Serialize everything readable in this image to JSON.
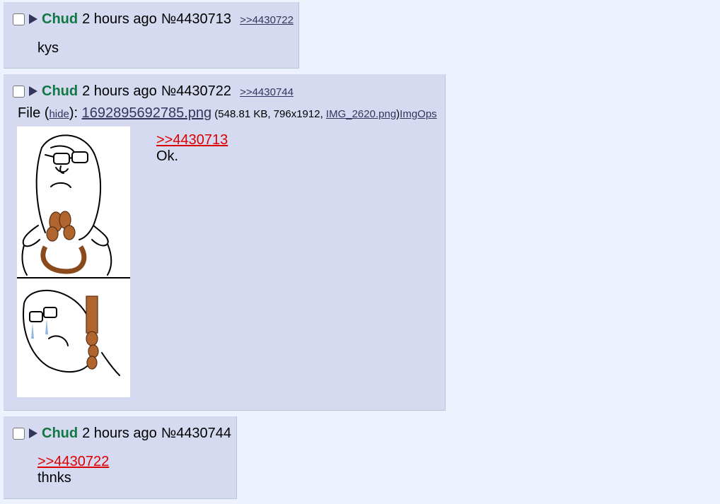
{
  "posts": [
    {
      "name": "Chud",
      "time": "2 hours ago",
      "number": "№4430713",
      "backlinks": [
        ">>4430722"
      ],
      "message": "kys"
    },
    {
      "name": "Chud",
      "time": "2 hours ago",
      "number": "№4430722",
      "backlinks": [
        ">>4430744"
      ],
      "file": {
        "prefix": "File (",
        "hide": "hide",
        "close": "): ",
        "filename": "1692895692785.png",
        "meta_open": " (548.81 KB, 796x1912, ",
        "orig_name": "IMG_2620.png",
        "meta_close": ")",
        "imgops": "ImgOps"
      },
      "quote": ">>4430713",
      "message": "Ok."
    },
    {
      "name": "Chud",
      "time": "2 hours ago",
      "number": "№4430744",
      "quote": ">>4430722",
      "message": "thnks"
    }
  ],
  "icons": {
    "checkbox": "checkbox-icon",
    "menu": "post-menu-triangle-icon",
    "thumbnail": "wojak-noose-comic-thumbnail"
  },
  "colors": {
    "page_bg": "#eef2ff",
    "post_bg": "#d6daf0",
    "name": "#117743",
    "link": "#34345c",
    "quote": "#dd0000"
  }
}
